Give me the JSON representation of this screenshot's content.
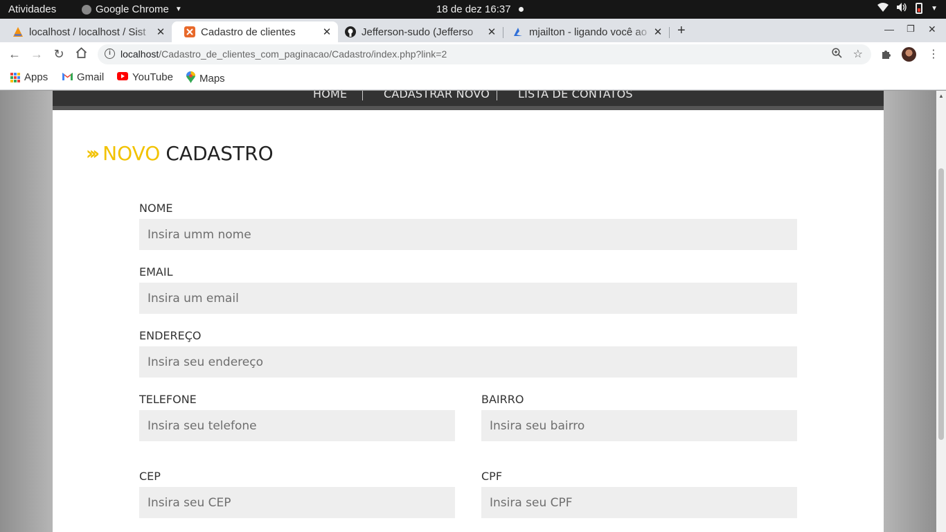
{
  "system_bar": {
    "activities": "Atividades",
    "app_name": "Google Chrome",
    "clock": "18 de dez  16:37"
  },
  "browser": {
    "tabs": [
      {
        "title": "localhost / localhost / Sist",
        "favicon_color": "#f29111"
      },
      {
        "title": "Cadastro de clientes",
        "favicon_color": "#e8692a"
      },
      {
        "title": "Jefferson-sudo (Jefferso",
        "favicon_color": "#222222"
      },
      {
        "title": "mjailton - ligando você ao",
        "favicon_color": "#2f6fd8"
      }
    ],
    "url_host": "localhost",
    "url_path": "/Cadastro_de_clientes_com_paginacao/Cadastro/index.php?link=2",
    "bookmarks": [
      "Apps",
      "Gmail",
      "YouTube",
      "Maps"
    ]
  },
  "site": {
    "nav": [
      "HOME",
      "CADASTRAR NOVO",
      "LISTA DE CONTATOS"
    ],
    "heading_accent": "NOVO",
    "heading_main": "CADASTRO",
    "accent_color": "#f2c200",
    "fields": {
      "nome": {
        "label": "NOME",
        "placeholder": "Insira umm nome",
        "value": ""
      },
      "email": {
        "label": "EMAIL",
        "placeholder": "Insira um email",
        "value": ""
      },
      "endereco": {
        "label": "ENDEREÇO",
        "placeholder": "Insira seu endereço",
        "value": ""
      },
      "telefone": {
        "label": "TELEFONE",
        "placeholder": "Insira seu telefone",
        "value": ""
      },
      "bairro": {
        "label": "BAIRRO",
        "placeholder": "Insira seu bairro",
        "value": ""
      },
      "cep": {
        "label": "CEP",
        "placeholder": "Insira seu CEP",
        "value": ""
      },
      "cpf": {
        "label": "CPF",
        "placeholder": "Insira seu CPF",
        "value": ""
      }
    }
  }
}
